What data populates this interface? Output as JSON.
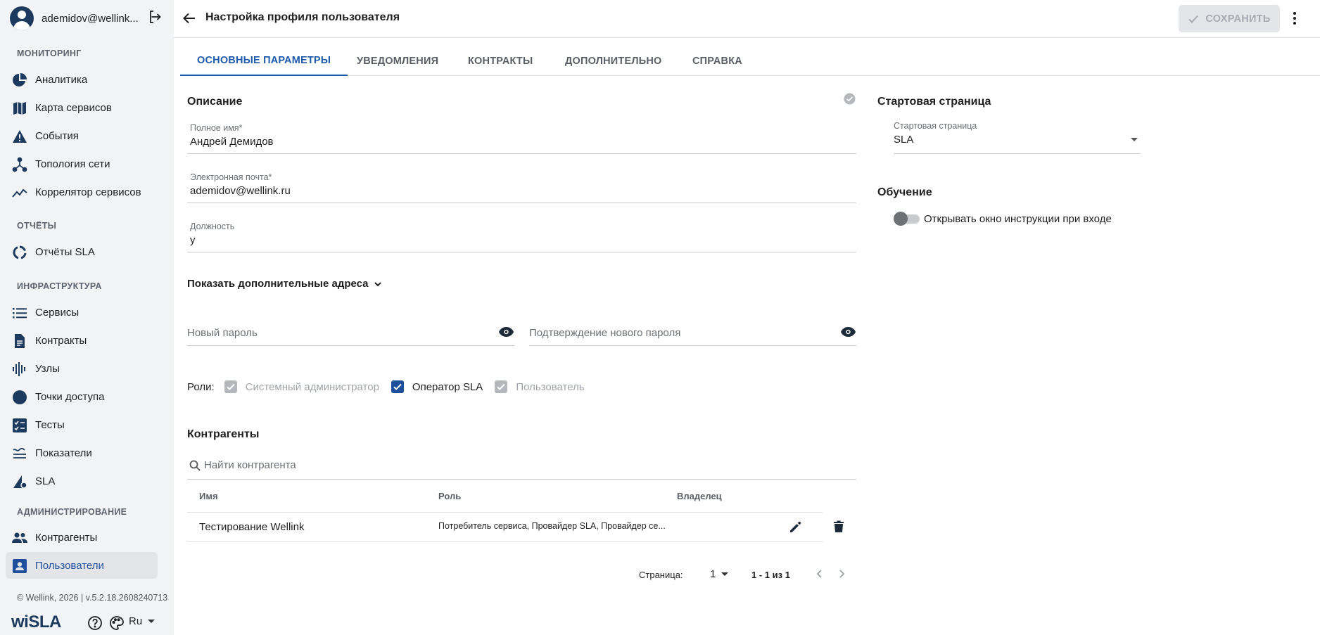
{
  "user": {
    "email": "ademidov@wellink..."
  },
  "sidebar": {
    "sections": [
      {
        "title": "МОНИТОРИНГ",
        "items": [
          {
            "label": "Аналитика",
            "icon": "pie-chart-icon"
          },
          {
            "label": "Карта сервисов",
            "icon": "map-icon"
          },
          {
            "label": "События",
            "icon": "warning-icon"
          },
          {
            "label": "Топология сети",
            "icon": "topology-icon"
          },
          {
            "label": "Коррелятор сервисов",
            "icon": "trend-icon"
          }
        ]
      },
      {
        "title": "ОТЧЁТЫ",
        "items": [
          {
            "label": "Отчёты SLA",
            "icon": "donut-icon"
          }
        ]
      },
      {
        "title": "ИНФРАСТРУКТУРА",
        "items": [
          {
            "label": "Сервисы",
            "icon": "list-icon"
          },
          {
            "label": "Контракты",
            "icon": "document-icon"
          },
          {
            "label": "Узлы",
            "icon": "bars-icon"
          },
          {
            "label": "Точки доступа",
            "icon": "circle-icon"
          },
          {
            "label": "Тесты",
            "icon": "checklist-icon"
          },
          {
            "label": "Показатели",
            "icon": "metrics-icon"
          },
          {
            "label": "SLA",
            "icon": "sla-icon"
          }
        ]
      },
      {
        "title": "АДМИНИСТРИРОВАНИЕ",
        "items": [
          {
            "label": "Контрагенты",
            "icon": "people-icon"
          },
          {
            "label": "Пользователи",
            "icon": "user-card-icon",
            "active": true
          }
        ]
      }
    ],
    "copyright": "© Wellink, 2026 | v.5.2.18.2608240713",
    "logo": "wiSLA",
    "language": "Ru"
  },
  "header": {
    "title": "Настройка профиля пользователя",
    "save_label": "СОХРАНИТЬ"
  },
  "tabs": [
    "ОСНОВНЫЕ ПАРАМЕТРЫ",
    "УВЕДОМЛЕНИЯ",
    "КОНТРАКТЫ",
    "ДОПОЛНИТЕЛЬНО",
    "СПРАВКА"
  ],
  "form": {
    "description_title": "Описание",
    "full_name": {
      "label": "Полное имя*",
      "value": "Андрей Демидов"
    },
    "email": {
      "label": "Электронная почта*",
      "value": "ademidov@wellink.ru"
    },
    "position": {
      "label": "Должность",
      "value": "у"
    },
    "more_addresses": "Показать дополнительные адреса",
    "new_password": {
      "placeholder": "Новый пароль"
    },
    "confirm_password": {
      "placeholder": "Подтверждение нового пароля"
    },
    "roles_label": "Роли:",
    "roles": [
      {
        "label": "Системный администратор",
        "checked": true,
        "disabled": true
      },
      {
        "label": "Оператор SLA",
        "checked": true,
        "disabled": false
      },
      {
        "label": "Пользователь",
        "checked": true,
        "disabled": true
      }
    ]
  },
  "counterparties": {
    "title": "Контрагенты",
    "search_placeholder": "Найти контрагента",
    "columns": [
      "Имя",
      "Роль",
      "Владелец"
    ],
    "rows": [
      {
        "name": "Тестирование Wellink",
        "role": "Потребитель сервиса, Провайдер SLA, Провайдер се...",
        "owner": ""
      }
    ],
    "pager": {
      "page_label": "Страница:",
      "page": "1",
      "range": "1 - 1 из 1"
    }
  },
  "start_page": {
    "title": "Стартовая страница",
    "label": "Стартовая страница",
    "value": "SLA"
  },
  "training": {
    "title": "Обучение",
    "toggle_label": "Открывать окно инструкции при входе",
    "enabled": false
  },
  "colors": {
    "accent": "#1e5aab",
    "sidebar_bg": "#f2f3f5",
    "active_item_bg": "#e3e5e9",
    "brand_dark": "#1c3a5e"
  }
}
